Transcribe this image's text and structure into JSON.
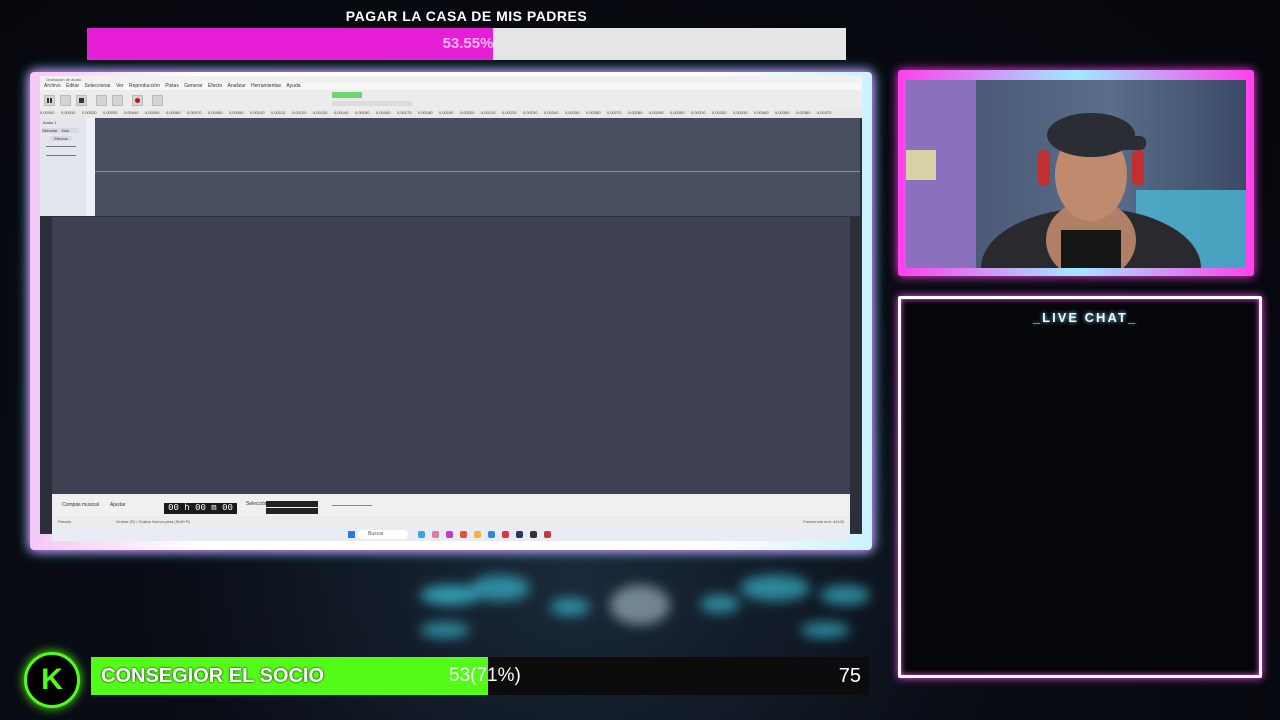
{
  "goal_top": {
    "title": "PAGAR LA CASA DE MIS PADRES",
    "percent_text": "53.55%",
    "progress": 0.5355,
    "fill_color": "#e61fd6"
  },
  "daw": {
    "window_title": "Grabación de audio",
    "menu": [
      "Archivo",
      "Editar",
      "Seleccionar",
      "Ver",
      "Reproducción",
      "Pistas",
      "Generar",
      "Efecto",
      "Analizar",
      "Herramientas",
      "Ayuda"
    ],
    "track_name": "Audio 1",
    "mute_label": "Silenciar",
    "solo_label": "Solo",
    "effects_label": "Efectos",
    "time_display": "00 h 00 m 00 s",
    "snap_label": "Ajustar",
    "project_rate_label": "Compás musical",
    "selection_label": "Selección",
    "status_left": "Parado.",
    "status_mid": "Grabar (R) / Grabar Nueva pista (Shift+R)",
    "status_right": "Frecuencia real: 44100",
    "search_placeholder": "Buscar"
  },
  "chat": {
    "title": "_LIVE CHAT_"
  },
  "kick": {
    "logo_letter": "K"
  },
  "sub_goal": {
    "label": "CONSEGIOR EL SOCIO",
    "progress_text": "53(71%)",
    "target": "75",
    "progress": 0.71,
    "fill_color": "#53fc18"
  }
}
